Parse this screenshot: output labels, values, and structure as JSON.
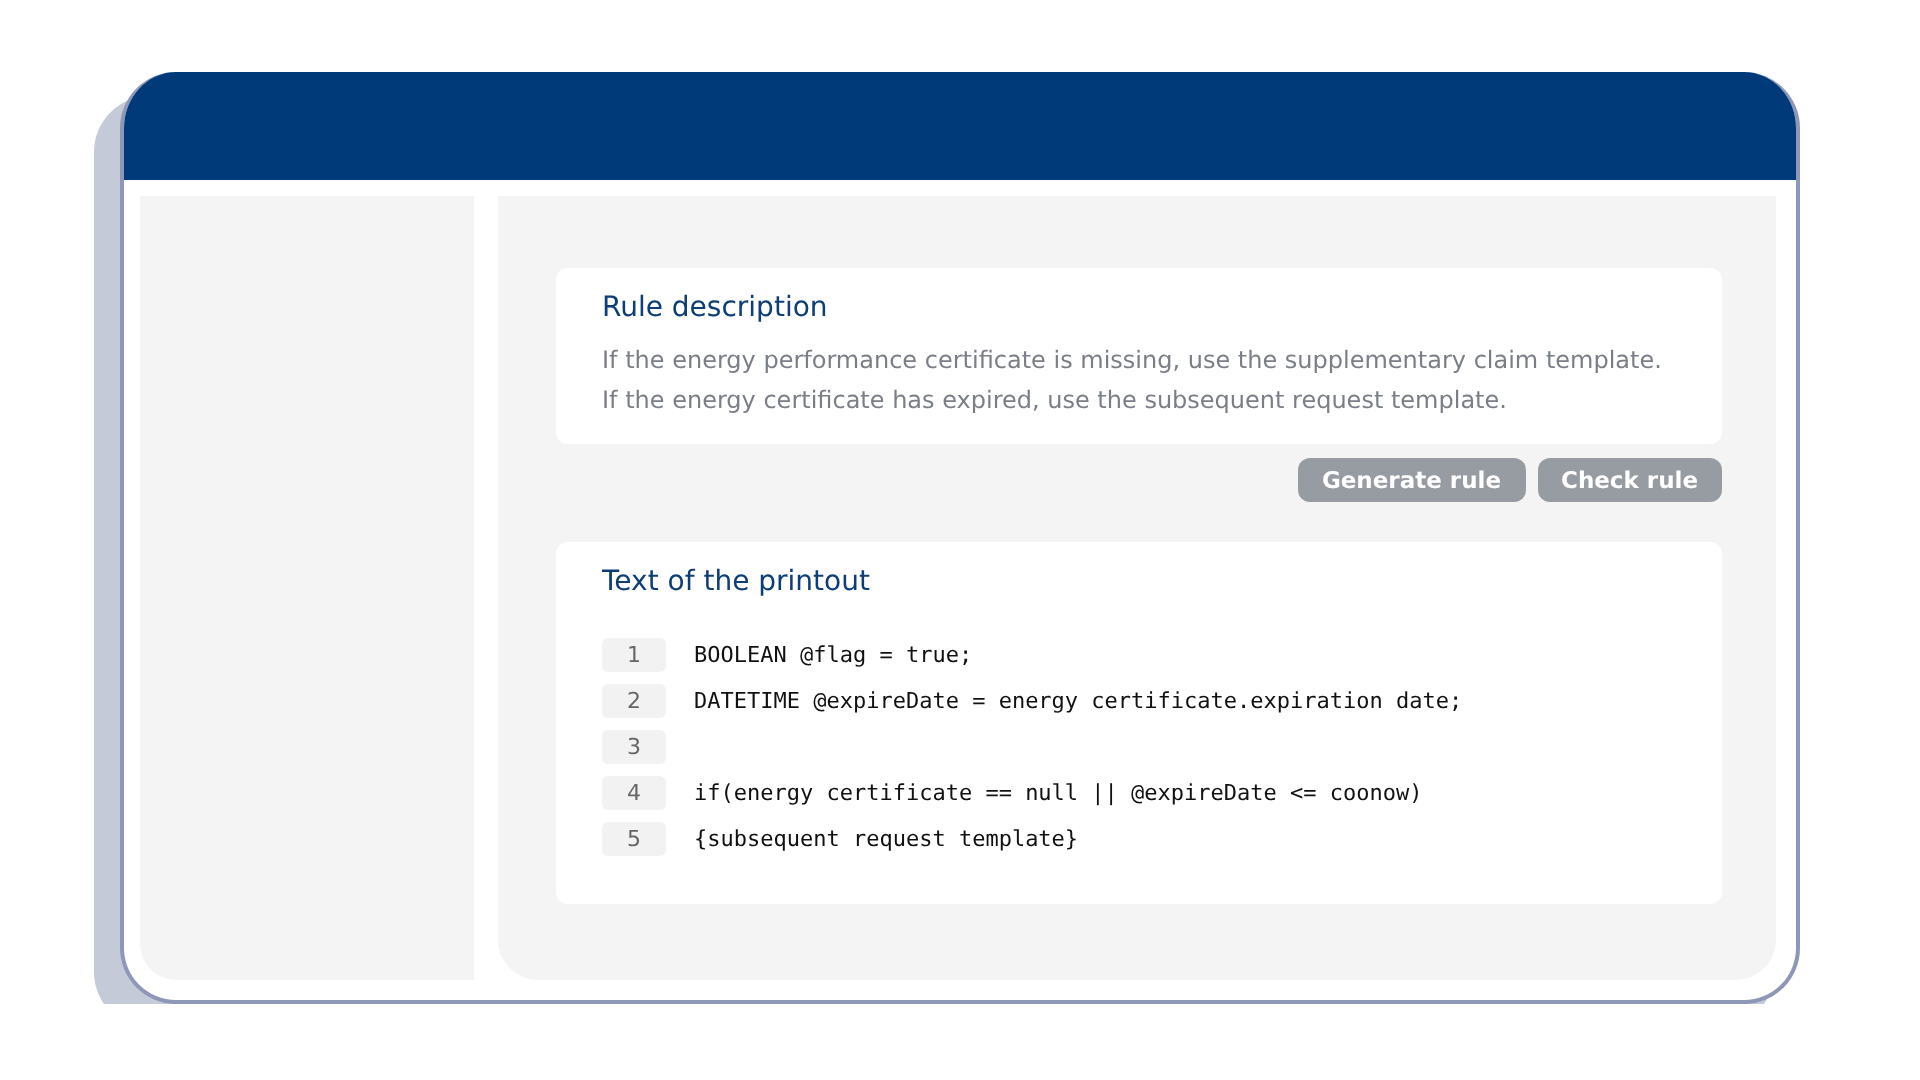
{
  "description_card": {
    "title": "Rule description",
    "text": "If the energy performance certificate is missing, use the supplementary claim template. If the energy certificate has expired, use the subsequent request template."
  },
  "buttons": [
    {
      "label": "Generate rule"
    },
    {
      "label": "Check rule"
    }
  ],
  "printout_card": {
    "title": "Text of the printout",
    "lines": [
      {
        "number": "1",
        "code": "BOOLEAN @flag = true;"
      },
      {
        "number": "2",
        "code": "DATETIME @expireDate = energy certificate.expiration date;"
      },
      {
        "number": "3"
      },
      {
        "number": "4",
        "code": "if(energy certificate == null || @expireDate <= coonow)"
      },
      {
        "number": "5",
        "code": "{subsequent request template}"
      }
    ]
  }
}
